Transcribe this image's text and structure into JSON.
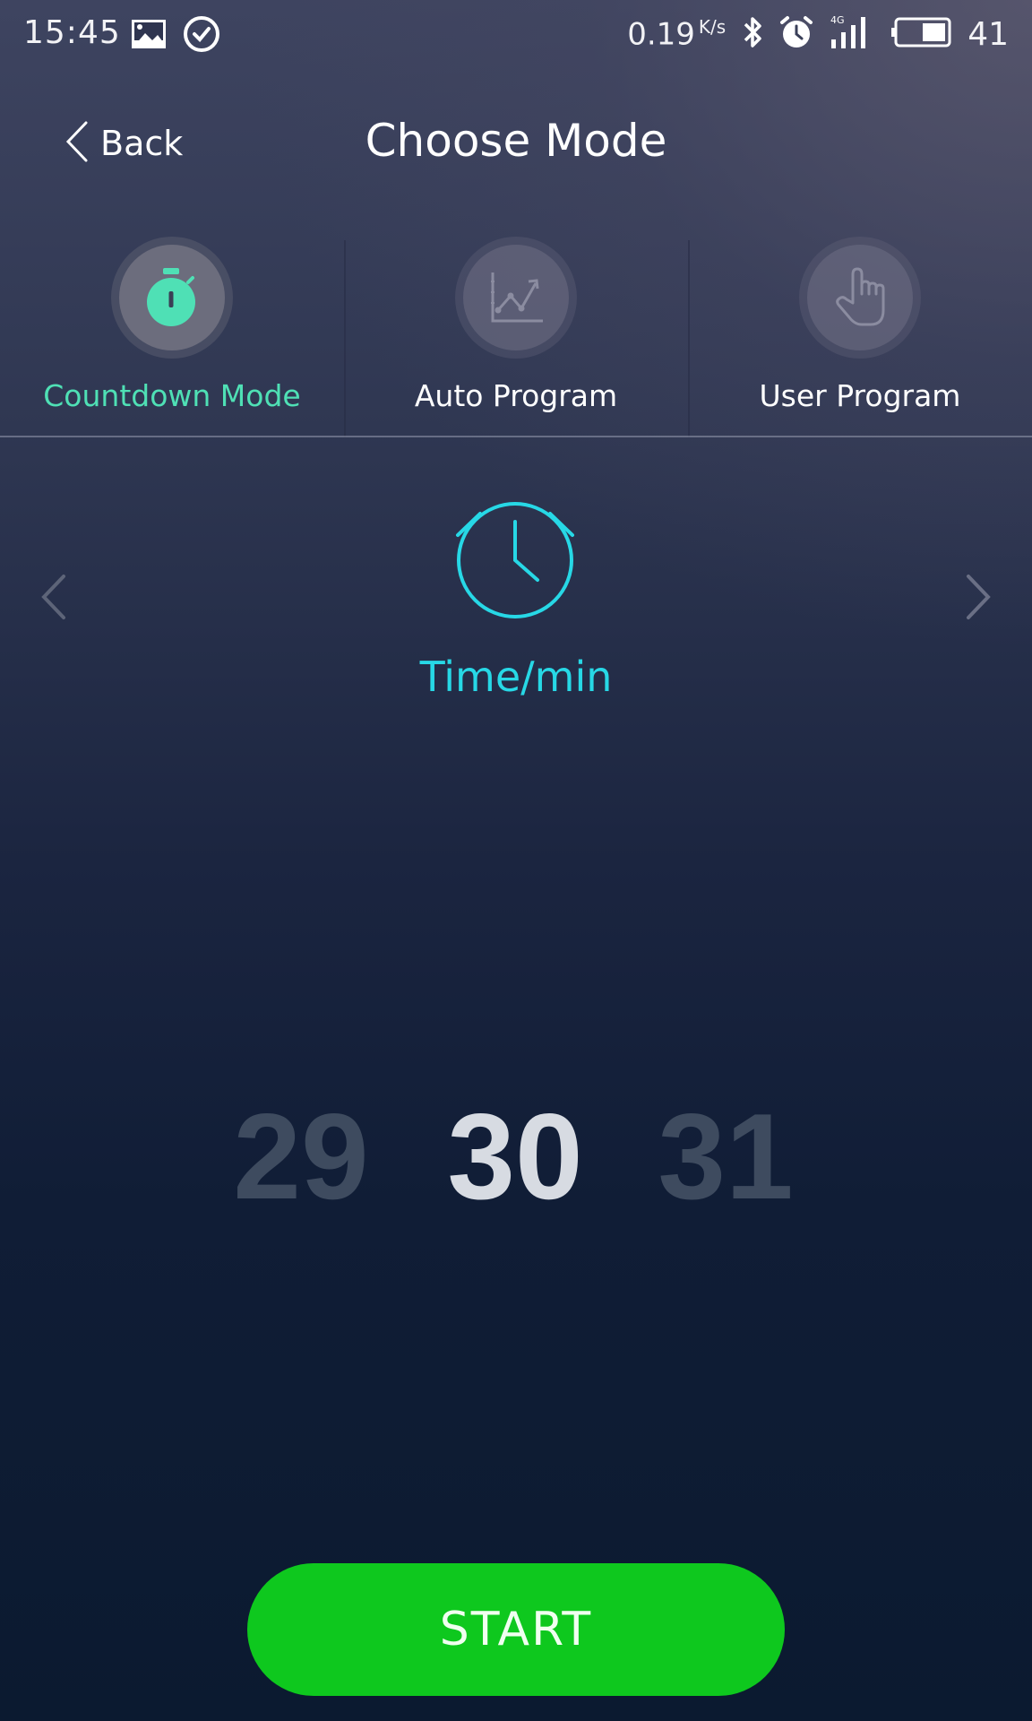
{
  "status_bar": {
    "time": "15:45",
    "left_icons": [
      "image-icon",
      "check-circle-icon"
    ],
    "net_speed": "0.19",
    "net_unit": "K/s",
    "right_icons": [
      "bluetooth-icon",
      "alarm-icon",
      "signal-4g-icon",
      "battery-icon"
    ],
    "network_type": "4G",
    "battery_percent": "41"
  },
  "header": {
    "back_label": "Back",
    "title": "Choose Mode"
  },
  "modes": [
    {
      "label": "Countdown Mode",
      "icon": "stopwatch-icon",
      "active": true
    },
    {
      "label": "Auto Program",
      "icon": "chart-trend-icon",
      "active": false
    },
    {
      "label": "User Program",
      "icon": "hand-pointer-icon",
      "active": false
    }
  ],
  "setting": {
    "icon": "alarm-clock-icon",
    "label": "Time/min"
  },
  "picker": {
    "previous": "29",
    "current": "30",
    "next": "31"
  },
  "start_label": "START",
  "colors": {
    "active_mode": "#4fe0b5",
    "accent_cyan": "#27d8e6",
    "start_button": "#0ec81e",
    "background_bottom": "#0b1a30"
  }
}
